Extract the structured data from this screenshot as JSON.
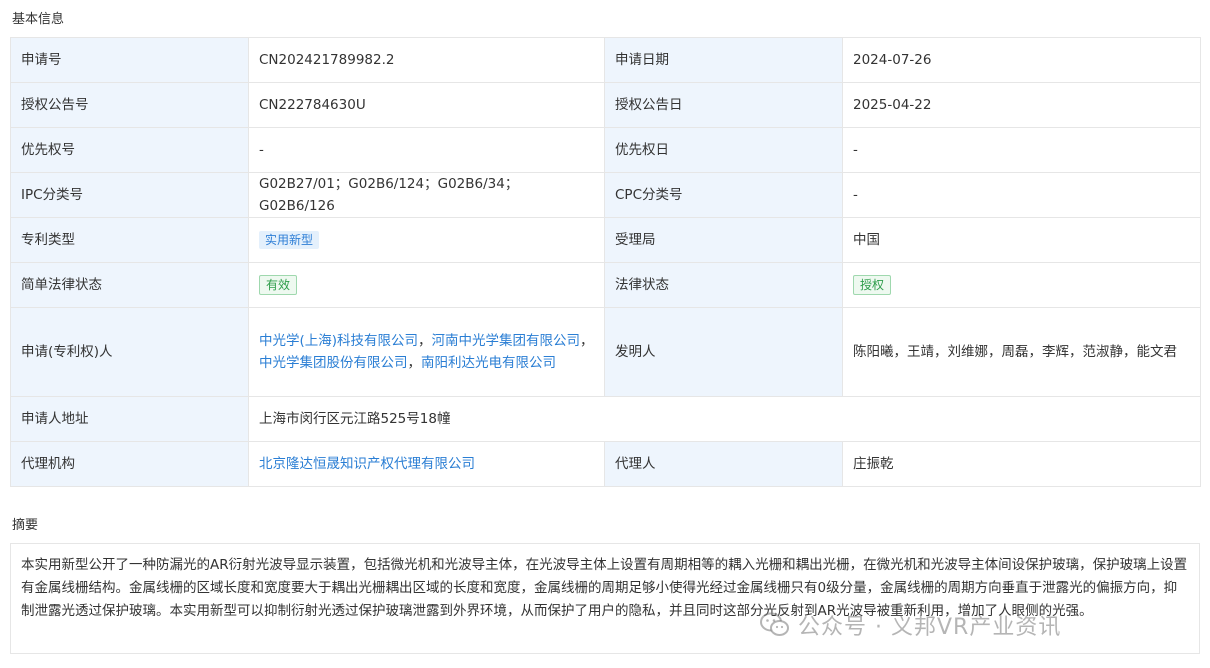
{
  "basic_title": "基本信息",
  "rows": [
    {
      "l1": "申请号",
      "v1": "CN202421789982.2",
      "l2": "申请日期",
      "v2": "2024-07-26"
    },
    {
      "l1": "授权公告号",
      "v1": "CN222784630U",
      "l2": "授权公告日",
      "v2": "2025-04-22"
    },
    {
      "l1": "优先权号",
      "v1": "-",
      "l2": "优先权日",
      "v2": "-"
    },
    {
      "l1": "IPC分类号",
      "v1": "G02B27/01；G02B6/124；G02B6/34；G02B6/126",
      "l2": "CPC分类号",
      "v2": "-"
    }
  ],
  "patent_type": {
    "label": "专利类型",
    "tag": "实用新型",
    "office_label": "受理局",
    "office": "中国"
  },
  "legal": {
    "simple_label": "简单法律状态",
    "simple_tag": "有效",
    "status_label": "法律状态",
    "status_tag": "授权"
  },
  "applicant": {
    "label": "申请(专利权)人",
    "names": [
      "中光学(上海)科技有限公司",
      "河南中光学集团有限公司",
      "中光学集团股份有限公司",
      "南阳利达光电有限公司"
    ],
    "sep": "，",
    "inventor_label": "发明人",
    "inventors": "陈阳曦，王靖，刘维娜，周磊，李辉，范淑静，能文君"
  },
  "address": {
    "label": "申请人地址",
    "value": "上海市闵行区元江路525号18幢"
  },
  "agency": {
    "label": "代理机构",
    "value": "北京隆达恒晟知识产权代理有限公司",
    "agent_label": "代理人",
    "agent": "庄振乾"
  },
  "abstract_title": "摘要",
  "abstract": "本实用新型公开了一种防漏光的AR衍射光波导显示装置，包括微光机和光波导主体，在光波导主体上设置有周期相等的耦入光栅和耦出光栅，在微光机和光波导主体间设保护玻璃，保护玻璃上设置有金属线栅结构。金属线栅的区域长度和宽度要大于耦出光栅耦出区域的长度和宽度，金属线栅的周期足够小使得光经过金属线栅只有0级分量，金属线栅的周期方向垂直于泄露光的偏振方向，抑制泄露光透过保护玻璃。本实用新型可以抑制衍射光透过保护玻璃泄露到外界环境，从而保护了用户的隐私，并且同时这部分光反射到AR光波导被重新利用，增加了人眼侧的光强。",
  "watermark": "公众号 · 义邦VR产业资讯"
}
